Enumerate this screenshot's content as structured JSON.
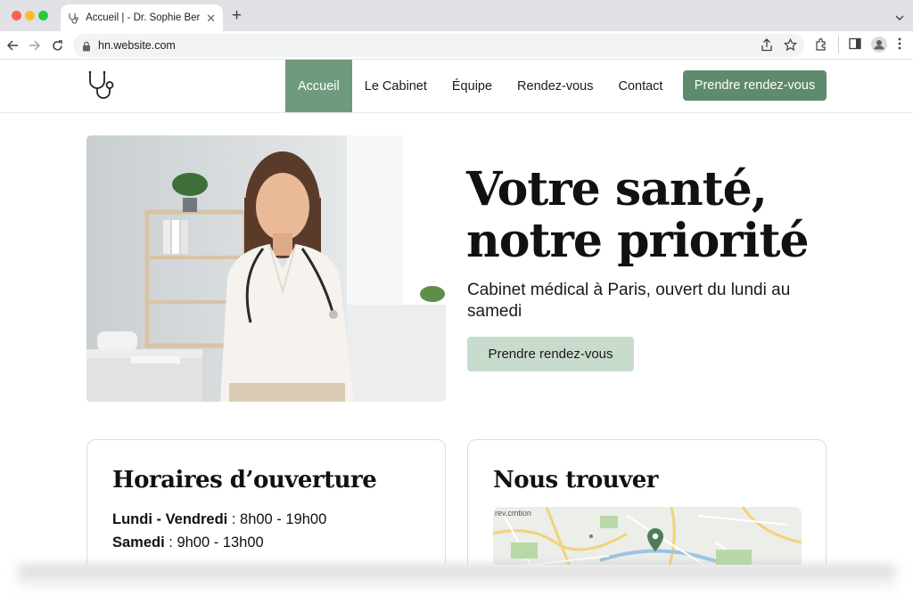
{
  "browser": {
    "tab_title": "Accueil | - Dr. Sophie Bernard",
    "url": "hn.website.com"
  },
  "site": {
    "nav": [
      {
        "label": "Accueil",
        "active": true
      },
      {
        "label": "Le Cabinet",
        "active": false
      },
      {
        "label": "Équipe",
        "active": false
      },
      {
        "label": "Rendez-vous",
        "active": false
      },
      {
        "label": "Contact",
        "active": false
      }
    ],
    "header_cta": "Prendre rendez-vous"
  },
  "hero": {
    "title_line1": "Votre santé,",
    "title_line2": "notre priorité",
    "subtitle": "Cabinet médical à Paris, ouvert du lundi au samedi",
    "cta": "Prendre rendez-vous"
  },
  "hours_card": {
    "title": "Horaires d’ouverture",
    "rows": [
      {
        "days": "Lundi - Vendredi",
        "time": " : 8h00 - 19h00"
      },
      {
        "days": "Samedi",
        "time": " : 9h00 - 13h00"
      }
    ]
  },
  "map_card": {
    "title": "Nous trouver",
    "map_label": "rev.cmtion"
  },
  "colors": {
    "accent": "#6e9b7d",
    "accent_dark": "#5e8b6c",
    "accent_light": "#c8dccd"
  },
  "icons": [
    "stethoscope-logo-icon",
    "back-icon",
    "forward-icon",
    "reload-icon",
    "lock-icon",
    "share-icon",
    "star-icon",
    "extensions-icon",
    "sidepanel-icon",
    "profile-icon",
    "menu-icon",
    "map-pin-icon"
  ]
}
